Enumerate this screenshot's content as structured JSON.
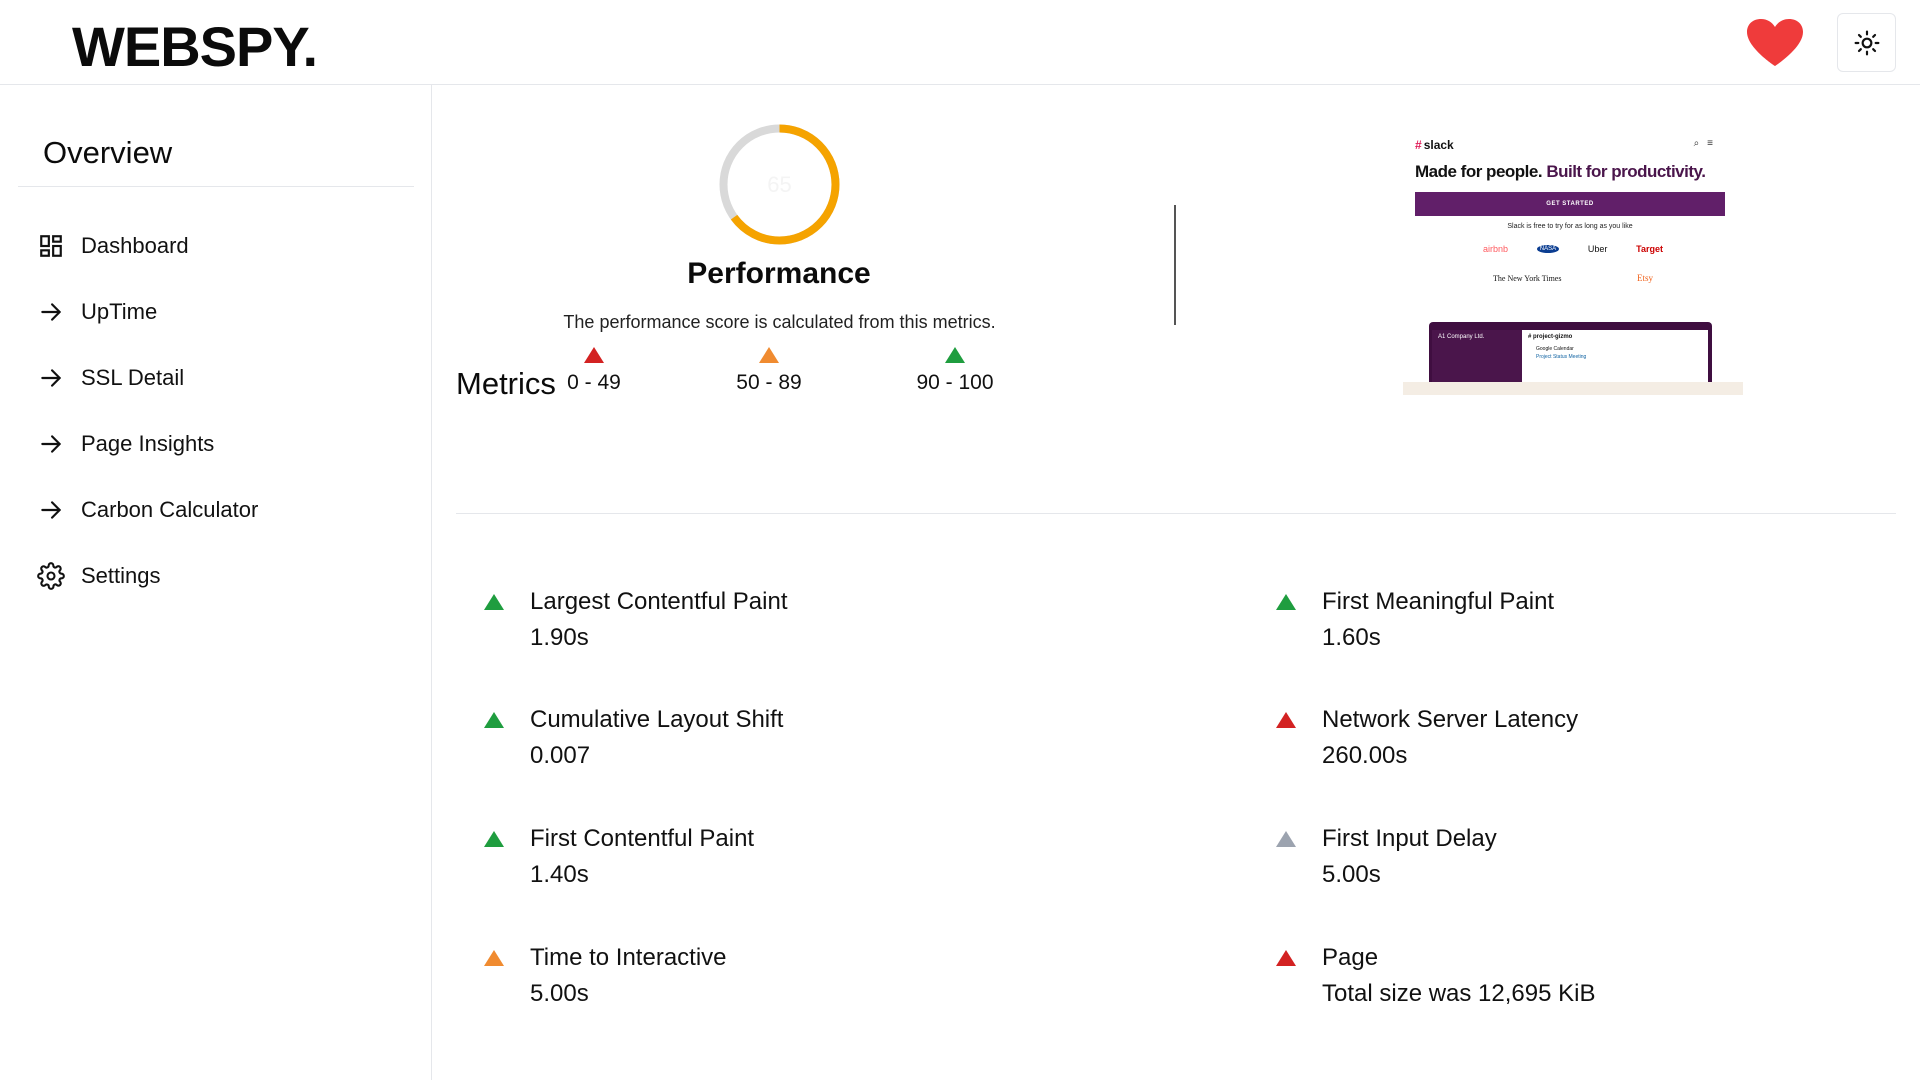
{
  "header": {
    "logo": "WEBSPY.",
    "favorite_icon": "heart-icon",
    "theme_icon": "sun-icon",
    "heart_color": "#ef3b3b"
  },
  "sidebar": {
    "title": "Overview",
    "items": [
      {
        "label": "Dashboard",
        "icon": "dashboard-grid-icon"
      },
      {
        "label": "UpTime",
        "icon": "arrow-right-icon"
      },
      {
        "label": "SSL Detail",
        "icon": "arrow-right-icon"
      },
      {
        "label": "Page Insights",
        "icon": "arrow-right-icon"
      },
      {
        "label": "Carbon Calculator",
        "icon": "arrow-right-icon"
      },
      {
        "label": "Settings",
        "icon": "gear-icon"
      }
    ]
  },
  "performance": {
    "score": "65",
    "score_fraction": 0.65,
    "gauge_color": "#f5a300",
    "title": "Performance",
    "description": "The performance score is calculated from this metrics.",
    "legend": [
      {
        "range": "0 - 49",
        "color": "#d32222"
      },
      {
        "range": "50 - 89",
        "color": "#f08b30"
      },
      {
        "range": "90 - 100",
        "color": "#1f9d3f"
      }
    ]
  },
  "preview": {
    "logo": "slack",
    "headline_plain": "Made for people.",
    "headline_accent": "Built for productivity.",
    "cta": "GET STARTED",
    "note": "Slack is free to try for as long as you like",
    "logos_row1": [
      "airbnb",
      "NASA",
      "Uber",
      "Target"
    ],
    "logos_row2": [
      "The New York Times",
      "Etsy"
    ],
    "app_company": "A1 Company Ltd.",
    "app_channel": "# project-gizmo",
    "app_calendar": "Google Calendar",
    "app_event": "Project Status Meeting"
  },
  "metrics": {
    "title": "Metrics",
    "items": [
      {
        "name": "Largest Contentful Paint",
        "value": "1.90s",
        "status": "good",
        "color": "#1f9d3f"
      },
      {
        "name": "First Meaningful Paint",
        "value": "1.60s",
        "status": "good",
        "color": "#1f9d3f"
      },
      {
        "name": "Cumulative Layout Shift",
        "value": "0.007",
        "status": "good",
        "color": "#1f9d3f"
      },
      {
        "name": "Network Server Latency",
        "value": "260.00s",
        "status": "poor",
        "color": "#d32222"
      },
      {
        "name": "First Contentful Paint",
        "value": "1.40s",
        "status": "good",
        "color": "#1f9d3f"
      },
      {
        "name": "First Input Delay",
        "value": "5.00s",
        "status": "neutral",
        "color": "#9ca3af"
      },
      {
        "name": "Time to Interactive",
        "value": "5.00s",
        "status": "average",
        "color": "#f08b30"
      },
      {
        "name": "Page",
        "value": "Total size was 12,695 KiB",
        "status": "poor",
        "color": "#d32222"
      }
    ]
  }
}
